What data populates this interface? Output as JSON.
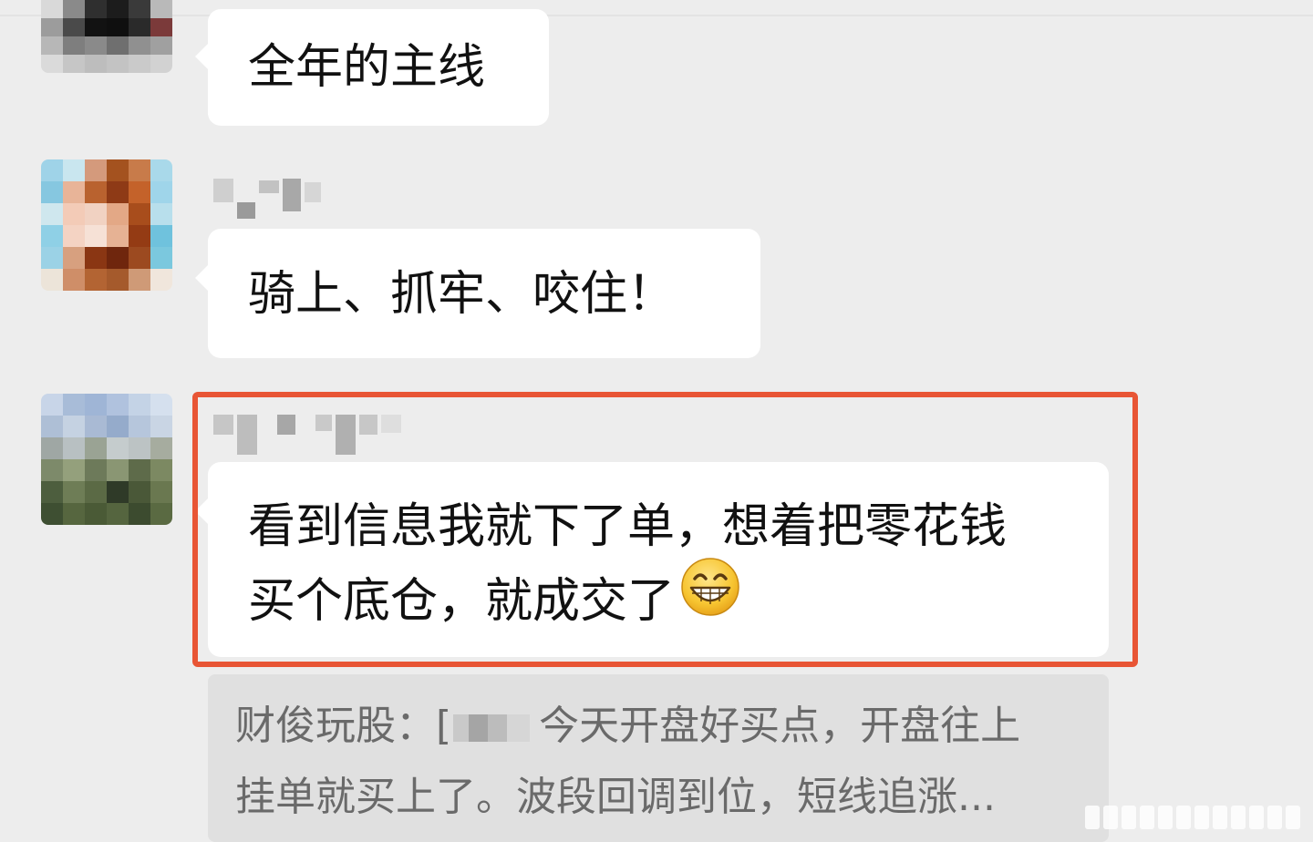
{
  "messages": [
    {
      "text": "全年的主线"
    },
    {
      "text": "骑上、抓牢、咬住！"
    },
    {
      "line1": "看到信息我就下了单，想着把零花钱",
      "line2": "买个底仓，就成交了",
      "emoji_icon": "grinning-face-icon"
    }
  ],
  "quote": {
    "prefix": "财俊玩股：[",
    "line1_rest": "今天开盘好买点，开盘往上",
    "line2": "挂单就买上了。波段回调到位，短线追涨..."
  },
  "colors": {
    "background": "#ededed",
    "bubble": "#ffffff",
    "highlight": "#e85535",
    "quote_bg": "#e0e0e0",
    "quote_text": "#6a6a6a"
  }
}
